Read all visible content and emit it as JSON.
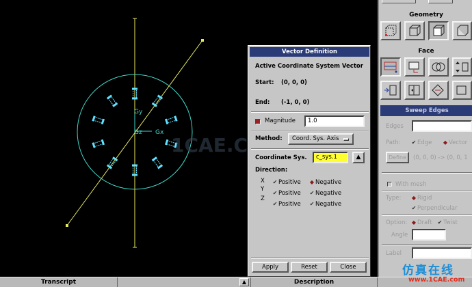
{
  "vector_dialog": {
    "title": "Vector Definition",
    "heading": "Active Coordinate System Vector",
    "start_label": "Start:",
    "start_value": "(0, 0, 0)",
    "end_label": "End:",
    "end_value": "(-1, 0, 0)",
    "magnitude_label": "Magnitude",
    "magnitude_value": "1.0",
    "method_label": "Method:",
    "method_value": "Coord. Sys. Axis",
    "coord_sys_label": "Coordinate Sys.",
    "coord_sys_value": "c_sys.1",
    "direction_label": "Direction:",
    "axes": [
      {
        "axis": "X",
        "positive": "Positive",
        "negative": "Negative",
        "selected": "negative"
      },
      {
        "axis": "Y",
        "positive": "Positive",
        "negative": "Negative",
        "selected": "none"
      },
      {
        "axis": "Z",
        "positive": "Positive",
        "negative": "Negative",
        "selected": "none"
      }
    ],
    "apply_label": "Apply",
    "reset_label": "Reset",
    "close_label": "Close"
  },
  "right_panel": {
    "geometry_header": "Geometry",
    "face_header": "Face",
    "sweep_title": "Sweep Edges",
    "edges_label": "Edges",
    "path_label": "Path:",
    "path_edge": "Edge",
    "path_vector": "Vector",
    "define_label": "Define",
    "define_value": "(0, 0, 0) -> (0, 0, 1",
    "with_mesh_label": "With mesh",
    "type_label": "Type:",
    "type_rigid": "Rigid",
    "type_perpendicular": "Perpendicular",
    "option_label": "Option:",
    "option_draft": "Draft",
    "option_twist": "Twist",
    "angle_label": "Angle",
    "label_label": "Label"
  },
  "bottom_bar": {
    "transcript_label": "Transcript",
    "description_label": "Description",
    "toggle_glyph": "▲"
  },
  "viewport": {
    "axis_y_label": "Gy",
    "axis_z_label": "Gz",
    "axis_x_label": "Gx",
    "watermark_text": "1CAE.COM",
    "colors": {
      "background": "#000000",
      "circle": "#40d8c8",
      "path_line": "#e8e860",
      "marks": "#60e0ff"
    }
  },
  "watermark_brand": {
    "cn_text": "仿真在线",
    "url_text": "www.1CAE.com"
  }
}
